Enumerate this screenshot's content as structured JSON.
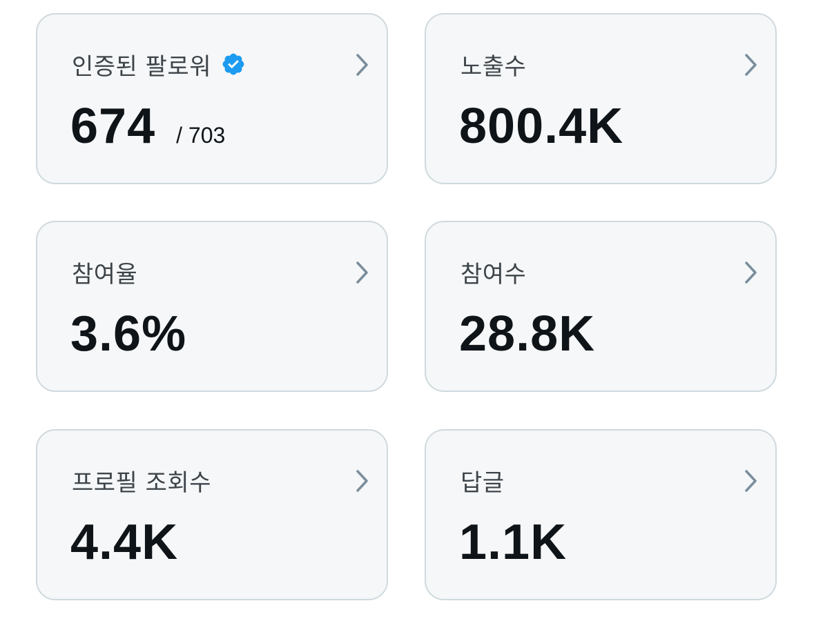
{
  "metrics": [
    {
      "label": "인증된 팔로워",
      "value": "674",
      "subvalue": "/ 703",
      "icon": "verified-badge-icon"
    },
    {
      "label": "노출수",
      "value": "800.4K"
    },
    {
      "label": "참여율",
      "value": "3.6%"
    },
    {
      "label": "참여수",
      "value": "28.8K"
    },
    {
      "label": "프로필 조회수",
      "value": "4.4K"
    },
    {
      "label": "답글",
      "value": "1.1K"
    }
  ],
  "colors": {
    "card_background": "#f5f7f8",
    "card_border": "#cfd9de",
    "verified_blue": "#1d9bf0",
    "chevron": "#7a8d9c",
    "value_text": "#0f1419",
    "label_text": "#3d4449"
  }
}
